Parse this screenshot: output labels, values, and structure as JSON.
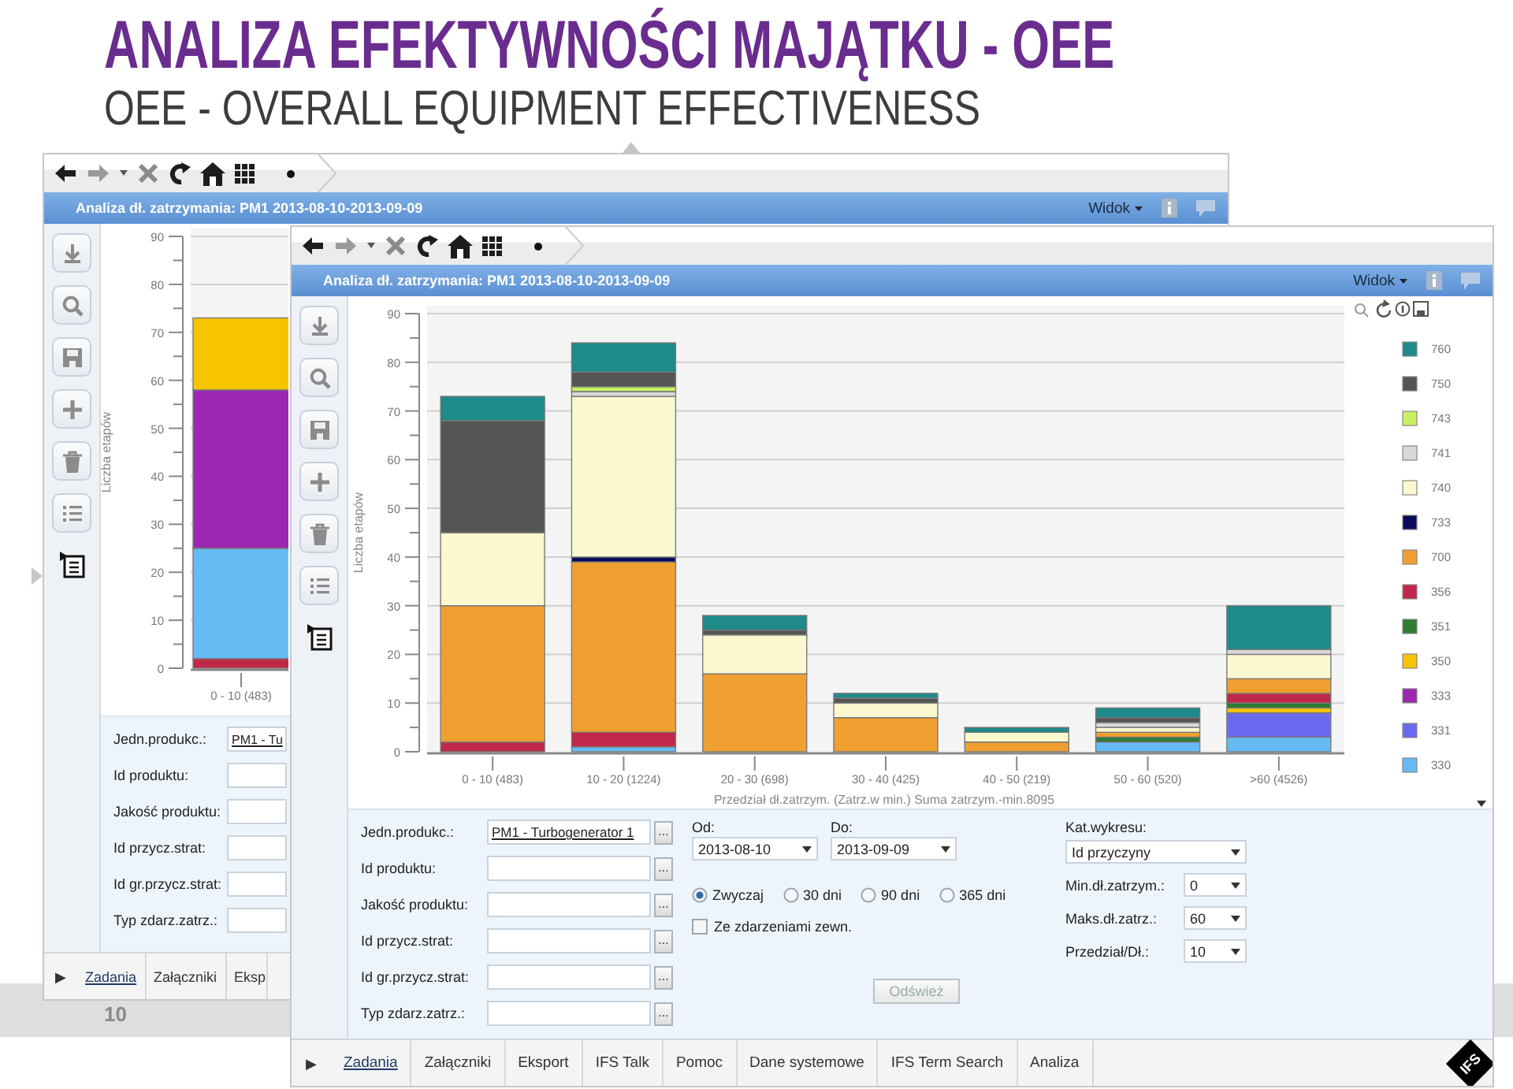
{
  "slide": {
    "title": "ANALIZA EFEKTYWNOŚCI MAJĄTKU - OEE",
    "subtitle": "OEE - OVERALL EQUIPMENT EFFECTIVENESS",
    "page_number": "10"
  },
  "windows": [
    {
      "title": "Analiza dł. zatrzymania: PM1 2013-08-10-2013-09-09",
      "view_menu": "Widok",
      "chart": {
        "chart_data": {
          "type": "bar",
          "ylabel": "Liczba etapów",
          "categories": [
            "0 - 10 (483)"
          ],
          "stacked": true,
          "grid": true,
          "ylim": [
            0,
            90
          ],
          "yticks": [
            0,
            10,
            20,
            30,
            40,
            50,
            60,
            70,
            80,
            90
          ],
          "series": [
            {
              "color": "#f6c500",
              "values": [
                15
              ]
            },
            {
              "color": "#9c27b0",
              "values": [
                33
              ]
            },
            {
              "color": "#66bbf5",
              "values": [
                23
              ]
            },
            {
              "color": "#c0284a",
              "values": [
                2
              ]
            }
          ]
        }
      },
      "form": {
        "fields": [
          {
            "label": "Jedn.produkc.:",
            "value": "PM1 - Tu",
            "link": true
          },
          {
            "label": "Id produktu:"
          },
          {
            "label": "Jakość produktu:"
          },
          {
            "label": "Id przycz.strat:"
          },
          {
            "label": "Id gr.przycz.strat:"
          },
          {
            "label": "Typ zdarz.zatrz.:"
          }
        ]
      },
      "tab_scroll": "▶",
      "tabs": [
        {
          "label": "Zadania",
          "selected": true
        },
        {
          "label": "Załączniki",
          "selected": false
        },
        {
          "label": "Eksp",
          "selected": false
        }
      ]
    },
    {
      "title": "Analiza dł. zatrzymania: PM1 2013-08-10-2013-09-09",
      "view_menu": "Widok",
      "chart": {
        "chart_data": {
          "type": "bar",
          "legend": "right",
          "xlabel": "Przedział dł.zatrzym. (Zatrz.w min.) Suma zatrzym.-min.8095",
          "ylabel": "Liczba etapów",
          "categories": [
            "0 - 10 (483)",
            "10 - 20 (1224)",
            "20 - 30 (698)",
            "30 - 40 (425)",
            "40 - 50 (219)",
            "50 - 60 (520)",
            ">60 (4526)"
          ],
          "stacked": true,
          "grid": true,
          "ylim": [
            0,
            90
          ],
          "yticks": [
            0,
            10,
            20,
            30,
            40,
            50,
            60,
            70,
            80,
            90
          ],
          "series": [
            {
              "name": "760",
              "color": "#1e8a8a",
              "values": [
                5,
                6,
                3,
                1,
                1,
                2,
                9
              ]
            },
            {
              "name": "750",
              "color": "#555555",
              "values": [
                23,
                3,
                1,
                1,
                null,
                1,
                null
              ]
            },
            {
              "name": "743",
              "color": "#c8f060",
              "values": [
                null,
                1,
                null,
                null,
                null,
                null,
                null
              ]
            },
            {
              "name": "741",
              "color": "#d8d8d8",
              "values": [
                null,
                1,
                null,
                null,
                null,
                1,
                1
              ]
            },
            {
              "name": "740",
              "color": "#fbf8cf",
              "values": [
                15,
                33,
                8,
                3,
                2,
                1,
                5
              ]
            },
            {
              "name": "733",
              "color": "#0a0a5a",
              "values": [
                null,
                1,
                null,
                null,
                null,
                null,
                null
              ]
            },
            {
              "name": "700",
              "color": "#f0a030",
              "values": [
                28,
                35,
                16,
                7,
                2,
                1,
                3
              ]
            },
            {
              "name": "356",
              "color": "#c0284a",
              "values": [
                2,
                3,
                null,
                null,
                null,
                null,
                2
              ]
            },
            {
              "name": "351",
              "color": "#2e7d32",
              "values": [
                null,
                null,
                null,
                null,
                null,
                1,
                1
              ]
            },
            {
              "name": "350",
              "color": "#f6c500",
              "values": [
                null,
                null,
                null,
                null,
                null,
                null,
                1
              ]
            },
            {
              "name": "333",
              "color": "#9c27b0",
              "values": [
                null,
                null,
                null,
                null,
                null,
                null,
                null
              ]
            },
            {
              "name": "331",
              "color": "#6a6af0",
              "values": [
                null,
                null,
                null,
                null,
                null,
                null,
                5
              ]
            },
            {
              "name": "330",
              "color": "#66bbf5",
              "values": [
                null,
                1,
                null,
                null,
                null,
                2,
                3
              ]
            }
          ]
        }
      },
      "form": {
        "fields": [
          {
            "label": "Jedn.produkc.:",
            "value": "PM1 - Turbogenerator 1",
            "link": true,
            "button": "..."
          },
          {
            "label": "Id produktu:",
            "button": "..."
          },
          {
            "label": "Jakość produktu:",
            "button": "..."
          },
          {
            "label": "Id przycz.strat:",
            "button": "..."
          },
          {
            "label": "Id gr.przycz.strat:",
            "button": "..."
          },
          {
            "label": "Typ zdarz.zatrz.:",
            "button": "..."
          }
        ],
        "date_from": {
          "label": "Od:",
          "value": "2013-08-10"
        },
        "date_to": {
          "label": "Do:",
          "value": "2013-09-09"
        },
        "periods": [
          {
            "label": "Zwyczaj",
            "selected": true
          },
          {
            "label": "30 dni",
            "selected": false
          },
          {
            "label": "90 dni",
            "selected": false
          },
          {
            "label": "365 dni",
            "selected": false
          }
        ],
        "external_events": {
          "label": "Ze zdarzeniami zewn.",
          "checked": false
        },
        "refresh_button": {
          "label": "Odśwież",
          "disabled": true
        },
        "options": [
          {
            "kind": "stacked",
            "label": "Kat.wykresu:",
            "value": "Id przyczyny"
          },
          {
            "kind": "inline",
            "label": "Min.dł.zatrzym.:",
            "value": "0"
          },
          {
            "kind": "inline",
            "label": "Maks.dł.zatrz.:",
            "value": "60"
          },
          {
            "kind": "inline",
            "label": "Przedział/Dł.:",
            "value": "10"
          }
        ]
      },
      "tab_scroll": "▶",
      "tabs": [
        {
          "label": "Zadania",
          "selected": true
        },
        {
          "label": "Załączniki",
          "selected": false
        },
        {
          "label": "Eksport",
          "selected": false
        },
        {
          "label": "IFS Talk",
          "selected": false
        },
        {
          "label": "Pomoc",
          "selected": false
        },
        {
          "label": "Dane systemowe",
          "selected": false
        },
        {
          "label": "IFS Term Search",
          "selected": false
        },
        {
          "label": "Analiza",
          "selected": false
        }
      ],
      "logo": "IFS"
    }
  ]
}
